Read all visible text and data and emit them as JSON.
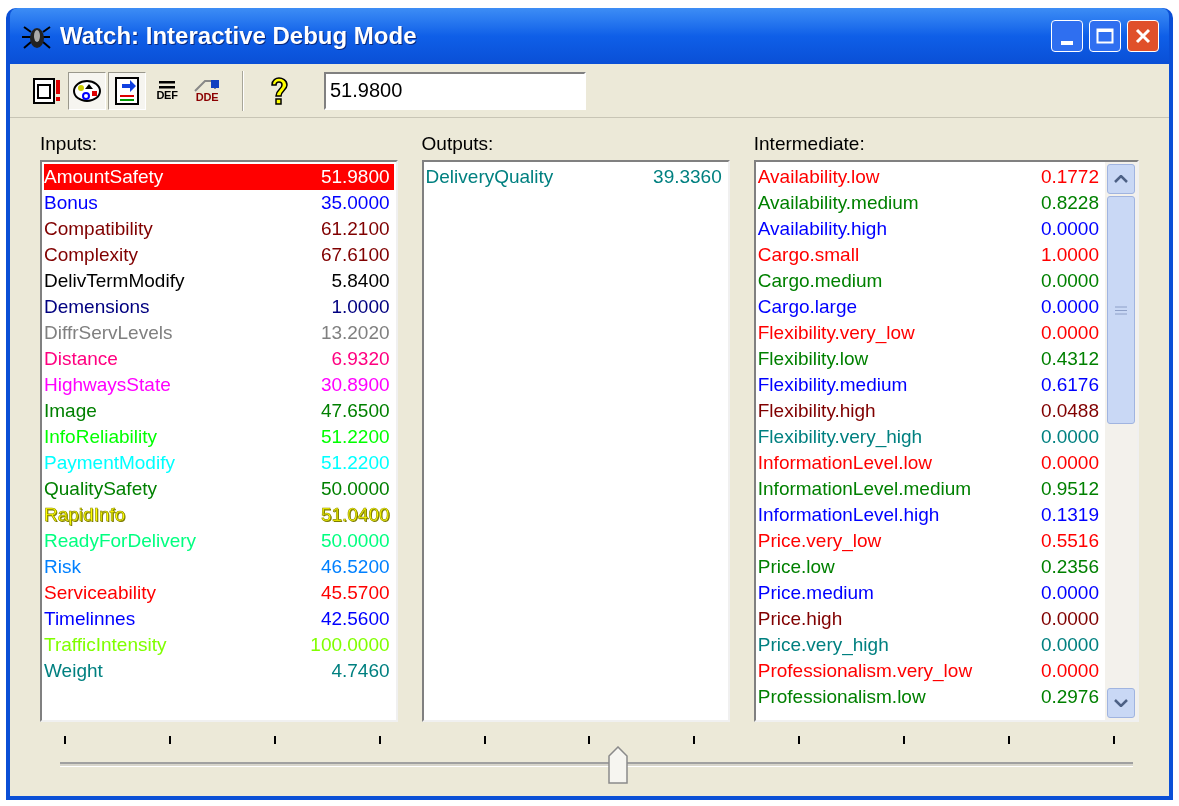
{
  "window": {
    "title": "Watch: Interactive Debug Mode"
  },
  "toolbar": {
    "buttons": [
      {
        "kind": "watch",
        "pressed": false
      },
      {
        "kind": "palette",
        "pressed": true
      },
      {
        "kind": "export",
        "pressed": true
      },
      {
        "kind": "text",
        "label": "DEF",
        "pressed": false
      },
      {
        "kind": "dde",
        "label": "DDE",
        "pressed": false
      },
      {
        "kind": "help",
        "pressed": false
      }
    ],
    "value_field": {
      "value": "51.9800"
    }
  },
  "inputs": {
    "label": "Inputs:",
    "rows": [
      {
        "name": "AmountSafety",
        "value": "51.9800",
        "color": "#ff0000",
        "selected": true
      },
      {
        "name": "Bonus",
        "value": "35.0000",
        "color": "#0000ff",
        "selected": false
      },
      {
        "name": "Compatibility",
        "value": "61.2100",
        "color": "#800000",
        "selected": false
      },
      {
        "name": "Complexity",
        "value": "67.6100",
        "color": "#800000",
        "selected": false
      },
      {
        "name": "DelivTermModify",
        "value": "5.8400",
        "color": "#000000",
        "selected": false
      },
      {
        "name": "Demensions",
        "value": "1.0000",
        "color": "#000080",
        "selected": false
      },
      {
        "name": "DiffrServLevels",
        "value": "13.2020",
        "color": "#808080",
        "selected": false
      },
      {
        "name": "Distance",
        "value": "6.9320",
        "color": "#ff0080",
        "selected": false
      },
      {
        "name": "HighwaysState",
        "value": "30.8900",
        "color": "#ff00ff",
        "selected": false
      },
      {
        "name": "Image",
        "value": "47.6500",
        "color": "#008000",
        "selected": false
      },
      {
        "name": "InfoReliability",
        "value": "51.2200",
        "color": "#00ff00",
        "selected": false
      },
      {
        "name": "PaymentModify",
        "value": "51.2200",
        "color": "#00ffff",
        "selected": false
      },
      {
        "name": "QualitySafety",
        "value": "50.0000",
        "color": "#008000",
        "selected": false
      },
      {
        "name": "RapidInfo",
        "value": "51.0400",
        "color": "#ffff00",
        "selected": false
      },
      {
        "name": "ReadyForDelivery",
        "value": "50.0000",
        "color": "#00ff80",
        "selected": false
      },
      {
        "name": "Risk",
        "value": "46.5200",
        "color": "#0080ff",
        "selected": false
      },
      {
        "name": "Serviceability",
        "value": "45.5700",
        "color": "#ff0000",
        "selected": false
      },
      {
        "name": "Timelinnes",
        "value": "42.5600",
        "color": "#0000ff",
        "selected": false
      },
      {
        "name": "TrafficIntensity",
        "value": "100.0000",
        "color": "#80ff00",
        "selected": false
      },
      {
        "name": "Weight",
        "value": "4.7460",
        "color": "#008080",
        "selected": false
      }
    ]
  },
  "outputs": {
    "label": "Outputs:",
    "rows": [
      {
        "name": "DeliveryQuality",
        "value": "39.3360",
        "color": "#008080",
        "selected": false
      }
    ]
  },
  "intermediate": {
    "label": "Intermediate:",
    "rows": [
      {
        "name": "Availability.low",
        "value": "0.1772",
        "color": "#ff0000",
        "selected": false
      },
      {
        "name": "Availability.medium",
        "value": "0.8228",
        "color": "#008000",
        "selected": false
      },
      {
        "name": "Availability.high",
        "value": "0.0000",
        "color": "#0000ff",
        "selected": false
      },
      {
        "name": "Cargo.small",
        "value": "1.0000",
        "color": "#ff0000",
        "selected": false
      },
      {
        "name": "Cargo.medium",
        "value": "0.0000",
        "color": "#008000",
        "selected": false
      },
      {
        "name": "Cargo.large",
        "value": "0.0000",
        "color": "#0000ff",
        "selected": false
      },
      {
        "name": "Flexibility.very_low",
        "value": "0.0000",
        "color": "#ff0000",
        "selected": false
      },
      {
        "name": "Flexibility.low",
        "value": "0.4312",
        "color": "#008000",
        "selected": false
      },
      {
        "name": "Flexibility.medium",
        "value": "0.6176",
        "color": "#0000ff",
        "selected": false
      },
      {
        "name": "Flexibility.high",
        "value": "0.0488",
        "color": "#800000",
        "selected": false
      },
      {
        "name": "Flexibility.very_high",
        "value": "0.0000",
        "color": "#008080",
        "selected": false
      },
      {
        "name": "InformationLevel.low",
        "value": "0.0000",
        "color": "#ff0000",
        "selected": false
      },
      {
        "name": "InformationLevel.medium",
        "value": "0.9512",
        "color": "#008000",
        "selected": false
      },
      {
        "name": "InformationLevel.high",
        "value": "0.1319",
        "color": "#0000ff",
        "selected": false
      },
      {
        "name": "Price.very_low",
        "value": "0.5516",
        "color": "#ff0000",
        "selected": false
      },
      {
        "name": "Price.low",
        "value": "0.2356",
        "color": "#008000",
        "selected": false
      },
      {
        "name": "Price.medium",
        "value": "0.0000",
        "color": "#0000ff",
        "selected": false
      },
      {
        "name": "Price.high",
        "value": "0.0000",
        "color": "#800000",
        "selected": false
      },
      {
        "name": "Price.very_high",
        "value": "0.0000",
        "color": "#008080",
        "selected": false
      },
      {
        "name": "Professionalism.very_low",
        "value": "0.0000",
        "color": "#ff0000",
        "selected": false
      },
      {
        "name": "Professionalism.low",
        "value": "0.2976",
        "color": "#008000",
        "selected": false
      }
    ]
  },
  "slider": {
    "level": 0.52
  }
}
